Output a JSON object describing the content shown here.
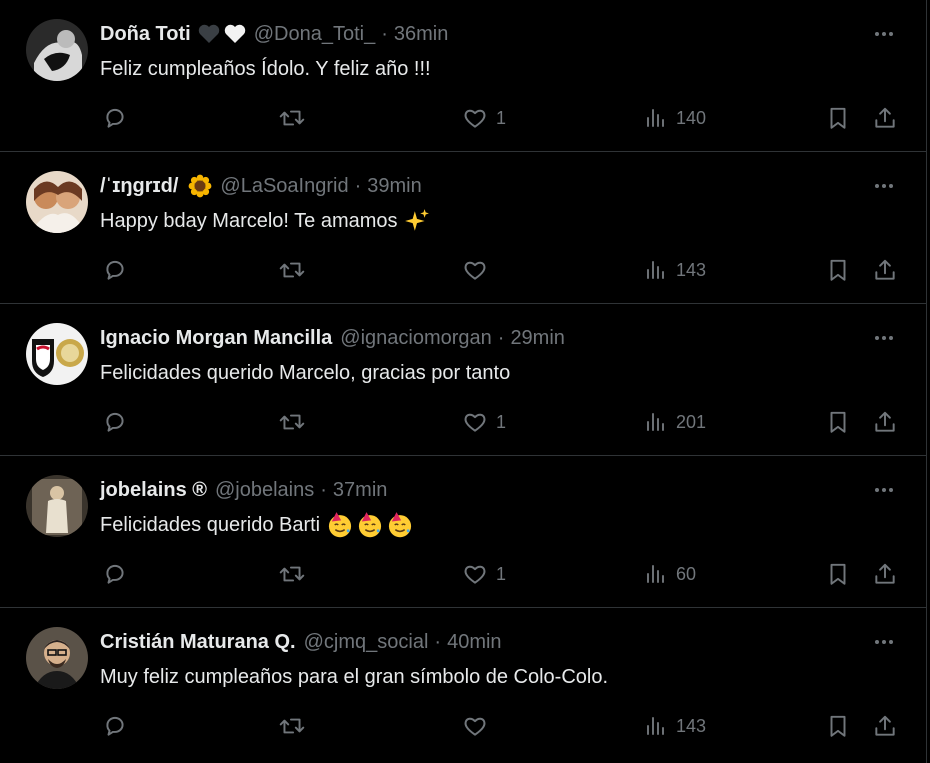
{
  "tweets": [
    {
      "name": "Doña Toti",
      "name_emojis": [
        "black-heart",
        "white-heart"
      ],
      "handle": "@Dona_Toti_",
      "separator": "·",
      "time": "36min",
      "text": "Feliz cumpleaños Ídolo. Y feliz año !!!",
      "text_emojis": [],
      "likes": "1",
      "views": "140"
    },
    {
      "name": "/ˈɪŋɡrɪd/",
      "name_emojis": [
        "sunflower"
      ],
      "handle": "@LaSoaIngrid",
      "separator": "·",
      "time": "39min",
      "text": "Happy bday Marcelo! Te amamos",
      "text_emojis": [
        "sparkles"
      ],
      "likes": "",
      "views": "143"
    },
    {
      "name": "Ignacio Morgan Mancilla",
      "name_emojis": [],
      "handle": "@ignaciomorgan",
      "separator": "·",
      "time": "29min",
      "text": "Felicidades querido Marcelo, gracias por tanto",
      "text_emojis": [],
      "likes": "1",
      "views": "201"
    },
    {
      "name": "jobelains ®",
      "name_emojis": [],
      "handle": "@jobelains",
      "separator": "·",
      "time": "37min",
      "text": "Felicidades querido Barti",
      "text_emojis": [
        "partying-face",
        "partying-face",
        "partying-face"
      ],
      "likes": "1",
      "views": "60"
    },
    {
      "name": "Cristián Maturana Q.",
      "name_emojis": [],
      "handle": "@cjmq_social",
      "separator": "·",
      "time": "40min",
      "text": "Muy feliz cumpleaños para el gran símbolo de Colo-Colo.",
      "text_emojis": [],
      "likes": "",
      "views": "143"
    }
  ],
  "colors": {
    "background": "#000000",
    "text_primary": "#e7e9ea",
    "text_secondary": "#71767b",
    "divider": "#2f3336"
  },
  "icons": [
    "reply-icon",
    "retweet-icon",
    "like-icon",
    "views-icon",
    "bookmark-icon",
    "share-icon",
    "more-icon"
  ]
}
